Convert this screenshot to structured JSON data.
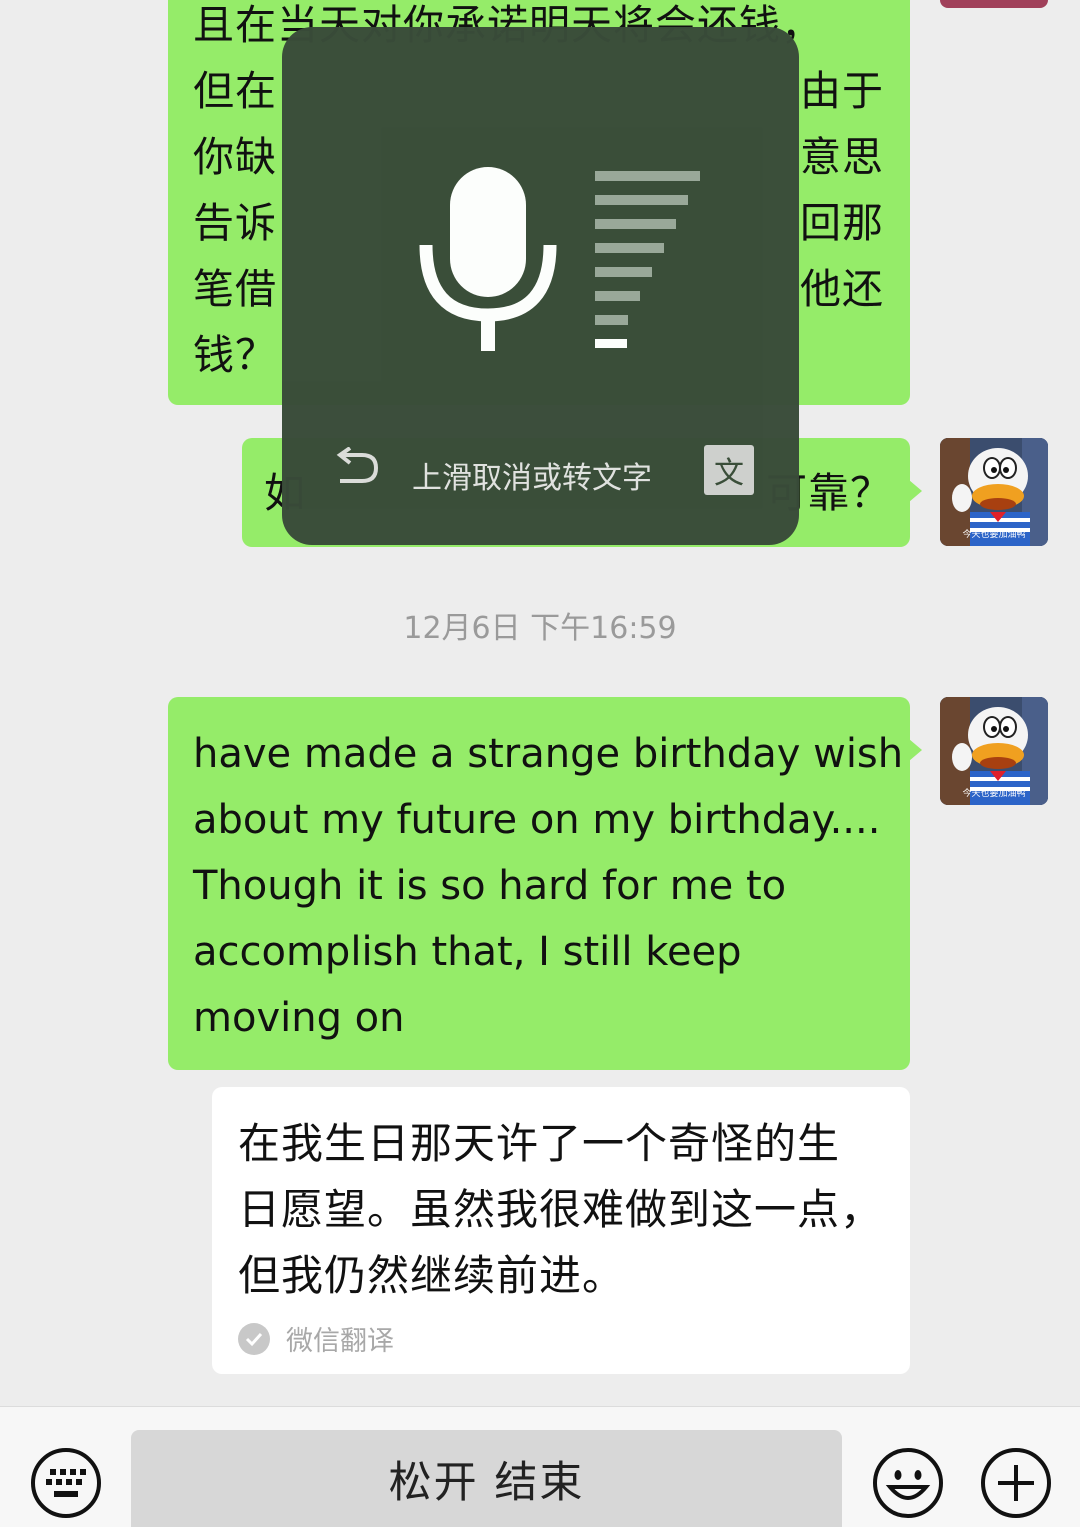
{
  "messages": {
    "first": {
      "lines": [
        "且在当天对你承诺明天将会还钱，",
        "但在",
        "你缺",
        "告诉",
        "笔借",
        "钱？"
      ],
      "right_fragments": [
        "由于",
        "意思",
        "回那",
        "他还"
      ]
    },
    "second": {
      "left_fragment": "如",
      "right_fragment": "可靠？"
    },
    "timestamp": "12月6日 下午16:59",
    "third": {
      "lines": [
        "have made a strange birthday wish",
        "about my future on my birthday....",
        "Though it is so hard for me to",
        "accomplish that, I still keep",
        "moving on"
      ]
    },
    "translation": {
      "lines": [
        "在我生日那天许了一个奇怪的生",
        "日愿望。虽然我很难做到这一点，",
        "但我仍然继续前进。"
      ],
      "source_label": "微信翻译"
    }
  },
  "avatar": {
    "caption": "今天也要加油鸭"
  },
  "voice_overlay": {
    "hint": "上滑取消或转文字",
    "convert_label": "文",
    "volume_level": 0.85
  },
  "bottom_bar": {
    "hold_button_label": "松开 结束"
  },
  "colors": {
    "bubble": "#95ec69",
    "overlay": "#394b39",
    "background": "#ededed"
  }
}
